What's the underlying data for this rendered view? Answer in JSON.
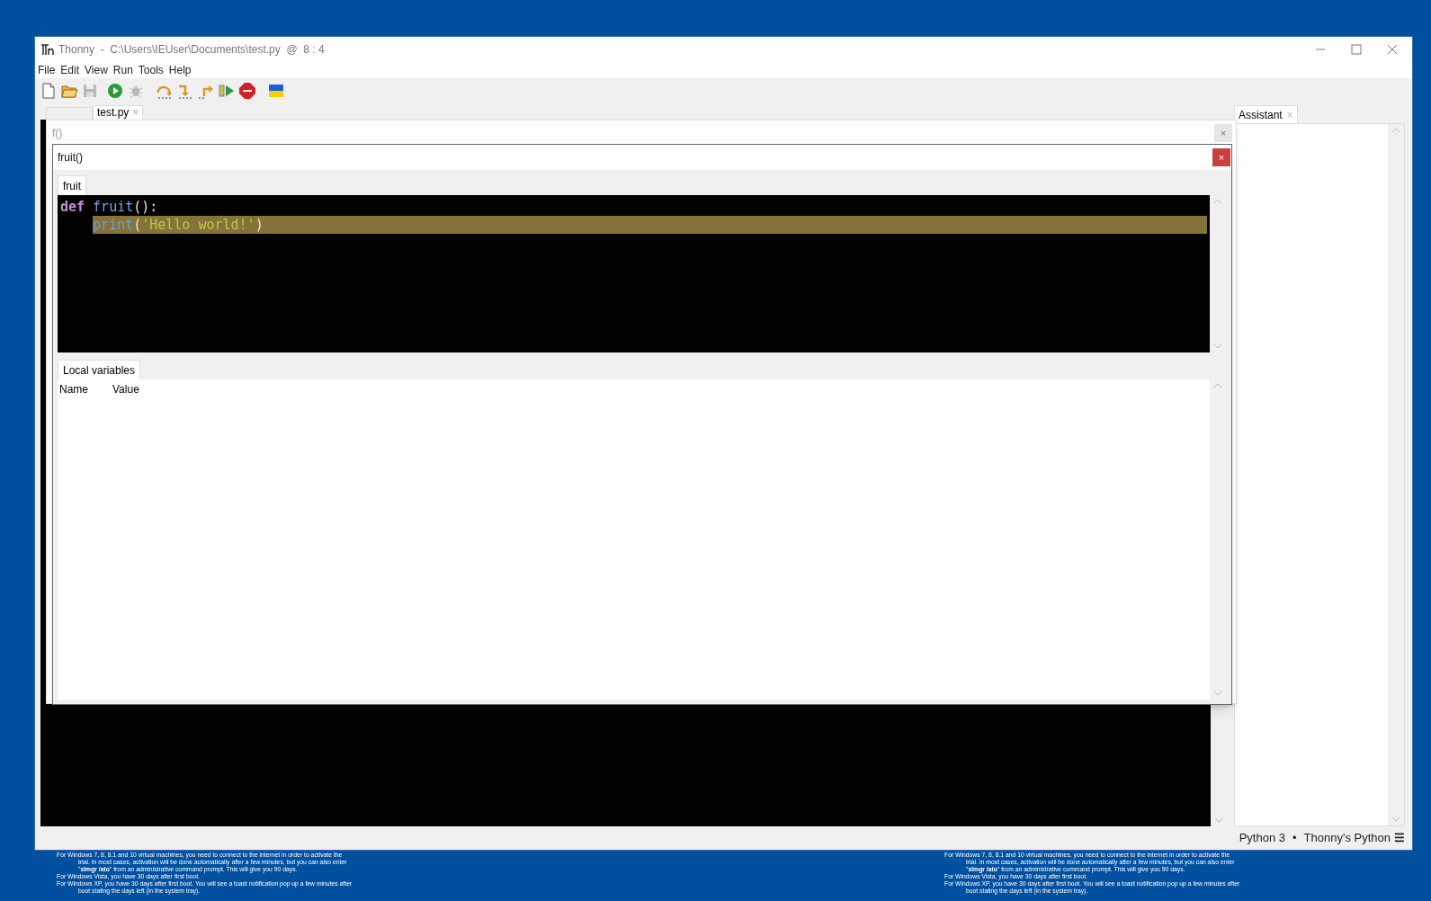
{
  "window": {
    "title": "Thonny  -  C:\\Users\\IEUser\\Documents\\test.py  @  8 : 4"
  },
  "menu": [
    "File",
    "Edit",
    "View",
    "Run",
    "Tools",
    "Help"
  ],
  "toolbar": [
    {
      "kind": "new",
      "disabled": false
    },
    {
      "kind": "open",
      "disabled": false
    },
    {
      "kind": "save",
      "disabled": true
    },
    {
      "kind": "run",
      "disabled": false
    },
    {
      "kind": "debug",
      "disabled": true
    },
    {
      "kind": "step_over",
      "disabled": false
    },
    {
      "kind": "step_into",
      "disabled": false
    },
    {
      "kind": "step_out",
      "disabled": false
    },
    {
      "kind": "resume",
      "disabled": false
    },
    {
      "kind": "stop",
      "disabled": false
    },
    {
      "kind": "flag",
      "disabled": false
    }
  ],
  "editor_tabs": [
    {
      "label": "test.py",
      "close": "×",
      "selected": true
    }
  ],
  "frame_popup": {
    "title": "f()",
    "close": "×"
  },
  "call_popup": {
    "title": "fruit()",
    "close": "×",
    "tab": "fruit",
    "code": [
      {
        "current": false,
        "tokens": [
          {
            "kind": "keyword",
            "text": "def"
          },
          {
            "kind": "name",
            "text": "fruit"
          },
          {
            "kind": "plain",
            "text": "():"
          }
        ],
        "children": [
          {
            "current": true,
            "tokens": [
              {
                "kind": "builtin",
                "text": "print"
              },
              {
                "kind": "plain",
                "text": "("
              },
              {
                "kind": "string",
                "text": "'Hello world!'"
              },
              {
                "kind": "plain",
                "text": ")"
              }
            ]
          }
        ]
      }
    ],
    "variables_tab": "Local variables",
    "columns": [
      "Name",
      "Value"
    ]
  },
  "side_tabs": [
    {
      "label": "Assistant",
      "close": "×",
      "selected": true
    }
  ],
  "status_bar": {
    "interpreter": "Python 3",
    "separator": "•",
    "backend": "Thonny's Python",
    "menu": "☰"
  },
  "desktop_notes": [
    {
      "paragraphs": [
        "For Windows 7, 8, 8.1 and 10 virtual machines, you need to connect to the internet in order to activate the trial. In most cases, activation will be done automatically after a few minutes, but you can also enter \"**slmgr /ato**\" from an administrative command prompt. This will give you 90 days.",
        "For Windows Vista, you have 30 days after first boot.",
        "For Windows XP, you have 30 days after first boot. You will see a toast notification pop up a few minutes after boot stating the days left (in the system tray)."
      ]
    },
    {
      "paragraphs": [
        "For Windows 7, 8, 8.1 and 10 virtual machines, you need to connect to the internet in order to activate the trial. In most cases, activation will be done automatically after a few minutes, but you can also enter \"**slmgr /ato**\" from an administrative command prompt. This will give you 90 days.",
        "For Windows Vista, you have 30 days after first boot.",
        "For Windows XP, you have 30 days after first boot. You will see a toast notification pop up a few minutes after boot stating the days left (in the system tray)."
      ]
    }
  ]
}
